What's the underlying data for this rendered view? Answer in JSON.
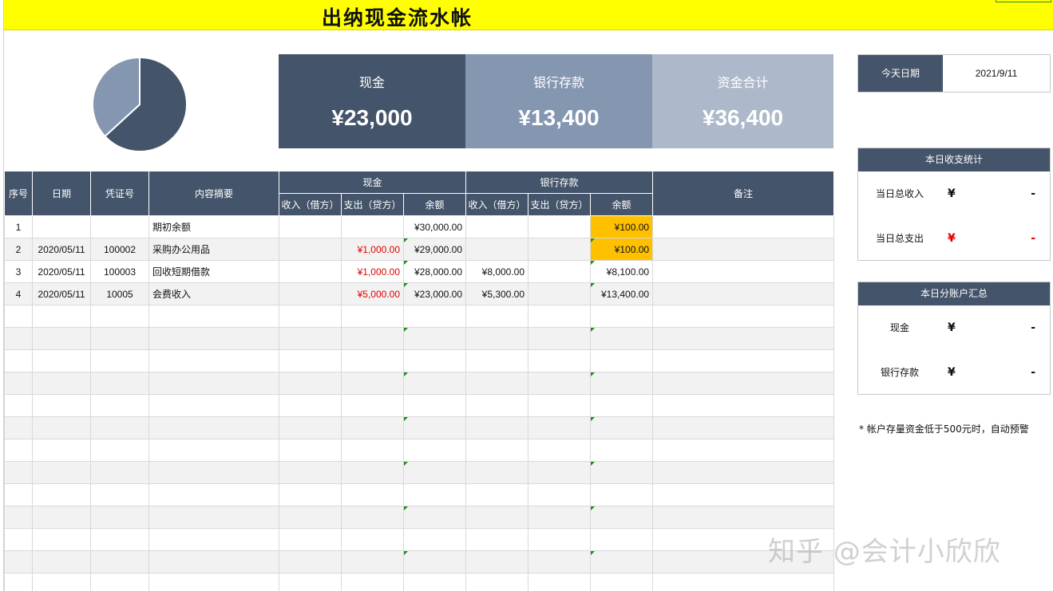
{
  "title": "出纳现金流水帐",
  "kpis": {
    "cash": {
      "label": "现金",
      "value": "¥23,000"
    },
    "bank": {
      "label": "银行存款",
      "value": "¥13,400"
    },
    "total": {
      "label": "资金合计",
      "value": "¥36,400"
    }
  },
  "pie": {
    "slices": [
      {
        "name": "现金",
        "value": 23000,
        "color": "#44546a"
      },
      {
        "name": "银行存款",
        "value": 13400,
        "color": "#8496b0"
      }
    ]
  },
  "today": {
    "label": "今天日期",
    "value": "2021/9/11"
  },
  "daily_stats": {
    "title": "本日收支统计",
    "rows": [
      {
        "label": "当日总收入",
        "symbol": "¥",
        "value": "-"
      },
      {
        "label": "当日总支出",
        "symbol": "¥",
        "value": "-"
      }
    ]
  },
  "account_summary": {
    "title": "本日分账户汇总",
    "rows": [
      {
        "label": "现金",
        "symbol": "¥",
        "value": "-"
      },
      {
        "label": "银行存款",
        "symbol": "¥",
        "value": "-"
      }
    ]
  },
  "note": "* 帐户存量资金低于500元时，自动预警",
  "watermark": "知乎 @会计小欣欣",
  "table": {
    "headers": {
      "seq": "序号",
      "date": "日期",
      "voucher": "凭证号",
      "summary": "内容摘要",
      "cash_group": "现金",
      "bank_group": "银行存款",
      "income": "收入（借方）",
      "expense": "支出（贷方）",
      "balance": "余额",
      "remark": "备注"
    },
    "rows": [
      {
        "seq": "1",
        "date": "",
        "voucher": "",
        "summary": "期初余额",
        "cash_in": "",
        "cash_out": "",
        "cash_bal": "¥30,000.00",
        "bank_in": "",
        "bank_out": "",
        "bank_bal": "¥100.00",
        "remark": ""
      },
      {
        "seq": "2",
        "date": "2020/05/11",
        "voucher": "100002",
        "summary": "采购办公用品",
        "cash_in": "",
        "cash_out": "¥1,000.00",
        "cash_bal": "¥29,000.00",
        "bank_in": "",
        "bank_out": "",
        "bank_bal": "¥100.00",
        "remark": ""
      },
      {
        "seq": "3",
        "date": "2020/05/11",
        "voucher": "100003",
        "summary": "回收短期借款",
        "cash_in": "",
        "cash_out": "¥1,000.00",
        "cash_bal": "¥28,000.00",
        "bank_in": "¥8,000.00",
        "bank_out": "",
        "bank_bal": "¥8,100.00",
        "remark": ""
      },
      {
        "seq": "4",
        "date": "2020/05/11",
        "voucher": "10005",
        "summary": "会费收入",
        "cash_in": "",
        "cash_out": "¥5,000.00",
        "cash_bal": "¥23,000.00",
        "bank_in": "¥5,300.00",
        "bank_out": "",
        "bank_bal": "¥13,400.00",
        "remark": ""
      }
    ]
  }
}
